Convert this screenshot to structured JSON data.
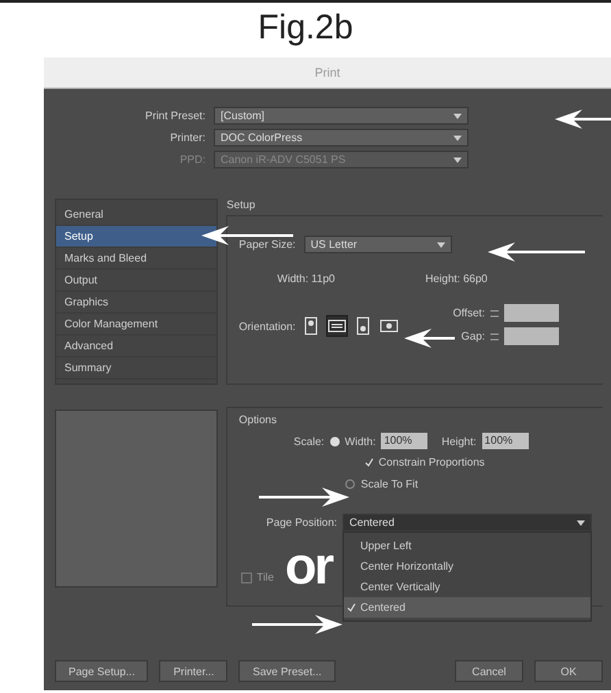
{
  "caption": "Fig.2b",
  "window": {
    "title": "Print"
  },
  "preset_rows": [
    {
      "label": "Print Preset:",
      "value": "[Custom]",
      "disabled": false
    },
    {
      "label": "Printer:",
      "value": "DOC ColorPress",
      "disabled": false
    },
    {
      "label": "PPD:",
      "value": "Canon iR-ADV C5051 PS",
      "disabled": true
    }
  ],
  "sidebar": {
    "items": [
      {
        "label": "General",
        "selected": false
      },
      {
        "label": "Setup",
        "selected": true
      },
      {
        "label": "Marks and Bleed",
        "selected": false
      },
      {
        "label": "Output",
        "selected": false
      },
      {
        "label": "Graphics",
        "selected": false
      },
      {
        "label": "Color Management",
        "selected": false
      },
      {
        "label": "Advanced",
        "selected": false
      },
      {
        "label": "Summary",
        "selected": false
      }
    ]
  },
  "setup": {
    "title": "Setup",
    "paper_size": {
      "label": "Paper Size:",
      "value": "US Letter"
    },
    "width": "Width: 11p0",
    "height": "Height: 66p0",
    "orientation": {
      "label": "Orientation:",
      "options": [
        {
          "kind": "portrait",
          "selected": false
        },
        {
          "kind": "landscape",
          "selected": true
        },
        {
          "kind": "reverse-portrait",
          "selected": false
        },
        {
          "kind": "reverse-landscape",
          "selected": false
        }
      ]
    },
    "offset_label": "Offset:",
    "gap_label": "Gap:"
  },
  "options": {
    "title": "Options",
    "scale": {
      "label": "Scale:",
      "selected": true,
      "width_label": "Width:",
      "width_value": "100%",
      "height_label": "Height:",
      "height_value": "100%"
    },
    "constrain": {
      "label": "Constrain Proportions",
      "checked": true
    },
    "scale_to_fit": {
      "label": "Scale To Fit",
      "selected": false
    },
    "page_position": {
      "label": "Page Position:",
      "value": "Centered",
      "menu": [
        {
          "label": "Upper Left",
          "selected": false
        },
        {
          "label": "Center Horizontally",
          "selected": false
        },
        {
          "label": "Center Vertically",
          "selected": false
        },
        {
          "label": "Centered",
          "selected": true
        }
      ]
    },
    "tile": {
      "label": "Tile",
      "checked": false
    }
  },
  "buttons": [
    {
      "label": "Page Setup...",
      "kind": "left"
    },
    {
      "label": "Printer...",
      "kind": "left"
    },
    {
      "label": "Save Preset...",
      "kind": "left"
    },
    {
      "label": "Cancel",
      "kind": "right"
    },
    {
      "label": "OK",
      "kind": "right"
    }
  ],
  "annotations": {
    "or_label": "or"
  }
}
